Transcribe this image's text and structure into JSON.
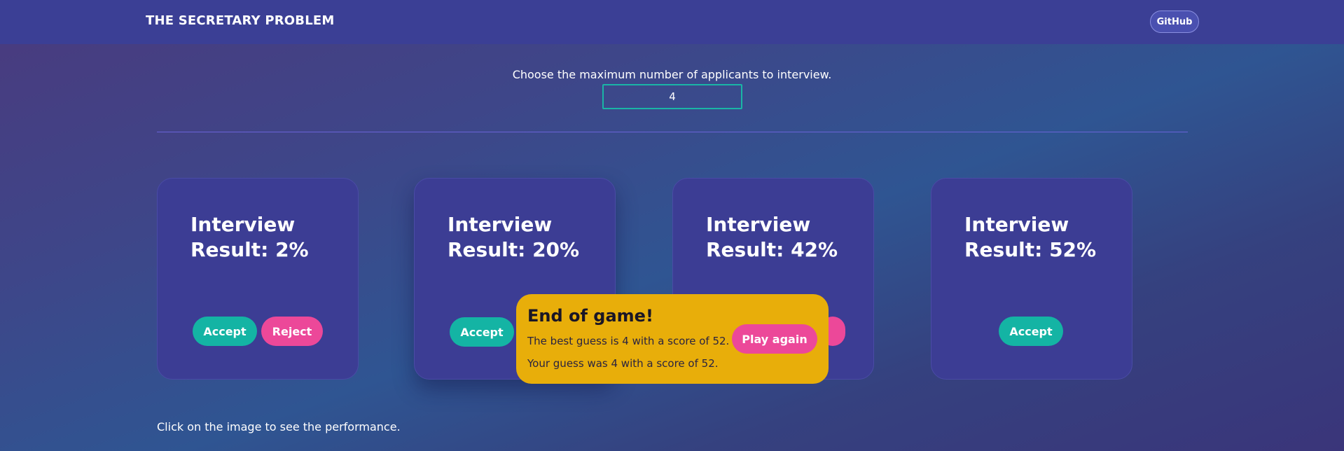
{
  "header": {
    "brand": "THE SECRETARY PROBLEM",
    "github_label": "GitHub"
  },
  "settings": {
    "prompt": "Choose the maximum number of applicants to interview.",
    "max_applicants": "4"
  },
  "cards": [
    {
      "title": "Interview Result: 2%",
      "accept_label": "Accept",
      "reject_label": "Reject"
    },
    {
      "title": "Interview Result: 20%",
      "accept_label": "Accept"
    },
    {
      "title": "Interview Result: 42%",
      "accept_label": "Accept"
    },
    {
      "title": "Interview Result: 52%",
      "accept_label": "Accept"
    }
  ],
  "modal": {
    "title": "End of game!",
    "best_guess_text": "The best guess is 4 with a score of 52.",
    "your_guess_text": "Your guess was 4 with a score of 52.",
    "play_again_label": "Play again"
  },
  "footer": {
    "hint": "Click on the image to see the performance."
  },
  "colors": {
    "accept": "#14b4a4",
    "reject": "#ec4899",
    "modal_bg": "#e8ae0a",
    "card_bg": "#3c3d94",
    "navbar_bg": "#3b3f95"
  }
}
